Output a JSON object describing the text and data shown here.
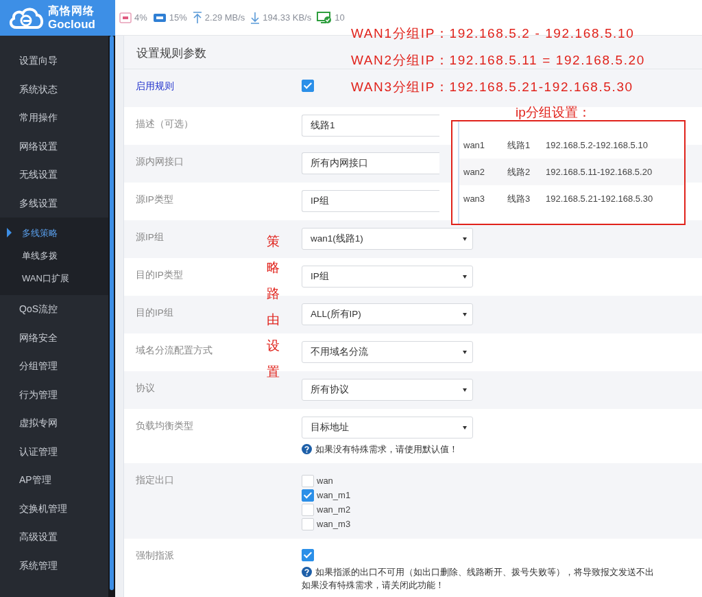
{
  "header": {
    "logo": {
      "name": "高恪网络",
      "brand": "Gocloud"
    },
    "stats": [
      {
        "kind": "cpu",
        "value": "4%"
      },
      {
        "kind": "ram",
        "value": "15%"
      },
      {
        "kind": "upload",
        "value": "2.29 MB/s"
      },
      {
        "kind": "download",
        "value": "194.33 KB/s"
      },
      {
        "kind": "clients",
        "value": "10"
      }
    ]
  },
  "sidebar": {
    "items": [
      {
        "label": "设置向导",
        "selected": false
      },
      {
        "label": "系统状态",
        "selected": false
      },
      {
        "label": "常用操作",
        "selected": false
      },
      {
        "label": "网络设置",
        "selected": false
      },
      {
        "label": "无线设置",
        "selected": false
      },
      {
        "label": "多线设置",
        "selected": false,
        "expanded": true,
        "children": [
          {
            "label": "多线策略",
            "selected": true
          },
          {
            "label": "单线多拨",
            "selected": false
          },
          {
            "label": "WAN口扩展",
            "selected": false
          }
        ]
      },
      {
        "label": "QoS流控",
        "selected": false
      },
      {
        "label": "网络安全",
        "selected": false
      },
      {
        "label": "分组管理",
        "selected": false
      },
      {
        "label": "行为管理",
        "selected": false
      },
      {
        "label": "虚拟专网",
        "selected": false
      },
      {
        "label": "认证管理",
        "selected": false
      },
      {
        "label": "AP管理",
        "selected": false
      },
      {
        "label": "交换机管理",
        "selected": false
      },
      {
        "label": "高级设置",
        "selected": false
      },
      {
        "label": "系统管理",
        "selected": false
      }
    ]
  },
  "form": {
    "title": "设置规则参数",
    "rows": [
      {
        "kind": "checkbox",
        "label": "启用规则",
        "highlighted": true,
        "checked": true
      },
      {
        "kind": "text",
        "label": "描述（可选）",
        "highlighted": false,
        "value": "线路1"
      },
      {
        "kind": "select",
        "label": "源内网接口",
        "highlighted": false,
        "value": "所有内网接口"
      },
      {
        "kind": "select",
        "label": "源IP类型",
        "highlighted": false,
        "value": "IP组"
      },
      {
        "kind": "select",
        "label": "源IP组",
        "highlighted": false,
        "value": "wan1(线路1)"
      },
      {
        "kind": "select",
        "label": "目的IP类型",
        "highlighted": false,
        "value": "IP组"
      },
      {
        "kind": "select",
        "label": "目的IP组",
        "highlighted": false,
        "value": "ALL(所有IP)"
      },
      {
        "kind": "select",
        "label": "域名分流配置方式",
        "highlighted": false,
        "value": "不用域名分流"
      },
      {
        "kind": "select",
        "label": "协议",
        "highlighted": false,
        "value": "所有协议"
      },
      {
        "kind": "select",
        "label": "负载均衡类型",
        "highlighted": false,
        "value": "目标地址",
        "hint": [
          "如果没有特殊需求，请使用默认值！"
        ]
      },
      {
        "kind": "checklist",
        "label": "指定出口",
        "highlighted": false,
        "options": [
          {
            "label": "wan",
            "checked": false
          },
          {
            "label": "wan_m1",
            "checked": true
          },
          {
            "label": "wan_m2",
            "checked": false
          },
          {
            "label": "wan_m3",
            "checked": false
          }
        ]
      },
      {
        "kind": "checkbox",
        "label": "强制指派",
        "highlighted": false,
        "checked": true,
        "hint": [
          "如果指派的出口不可用（如出口删除、线路断开、拨号失败等），将导致报文发送不出",
          "如果没有特殊需求，请关闭此功能！"
        ]
      }
    ]
  },
  "annotations": {
    "lines": [
      "WAN1分组IP：192.168.5.2 - 192.168.5.10",
      "WAN2分组IP：192.168.5.11 = 192.168.5.20",
      "WAN3分组IP：192.168.5.21-192.168.5.30"
    ],
    "group_title": "ip分组设置：",
    "group_rows": [
      [
        "wan1",
        "线路1",
        "192.168.5.2-192.168.5.10"
      ],
      [
        "wan2",
        "线路2",
        "192.168.5.11-192.168.5.20"
      ],
      [
        "wan3",
        "线路3",
        "192.168.5.21-192.168.5.30"
      ]
    ],
    "vertical_text": "策略路由设置"
  }
}
